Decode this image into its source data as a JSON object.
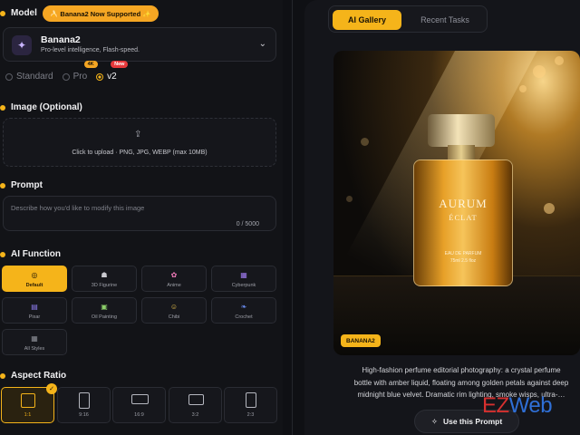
{
  "left": {
    "model": {
      "heading": "Model",
      "badge": "🍌 Banana2 Now Supported ✨",
      "name": "Banana2",
      "description": "Pro-level intelligence, Flash-speed.",
      "options": [
        {
          "label": "Standard",
          "selected": false
        },
        {
          "label": "Pro",
          "selected": false,
          "badge": "4K"
        },
        {
          "label": "v2",
          "selected": true,
          "badge": "New"
        }
      ]
    },
    "image": {
      "heading": "Image (Optional)",
      "upload_text": "Click to upload · PNG, JPG, WEBP (max 10MB)"
    },
    "prompt": {
      "heading": "Prompt",
      "placeholder": "Describe how you'd like to modify this image",
      "counter": "0 / 5000"
    },
    "ai_function": {
      "heading": "AI Function",
      "items": [
        {
          "label": "Default",
          "icon": "default-icon",
          "active": true
        },
        {
          "label": "3D Figurine",
          "icon": "figurine-icon",
          "active": false
        },
        {
          "label": "Anime",
          "icon": "anime-icon",
          "active": false
        },
        {
          "label": "Cyberpunk",
          "icon": "cyberpunk-icon",
          "active": false
        },
        {
          "label": "Pixar",
          "icon": "pixar-icon",
          "active": false
        },
        {
          "label": "Oil Painting",
          "icon": "oil-painting-icon",
          "active": false
        },
        {
          "label": "Chibi",
          "icon": "chibi-icon",
          "active": false
        },
        {
          "label": "Crochet",
          "icon": "crochet-icon",
          "active": false
        },
        {
          "label": "All Styles",
          "icon": "all-styles-icon",
          "active": false
        }
      ]
    },
    "aspect_ratio": {
      "heading": "Aspect Ratio",
      "items": [
        {
          "label": "1:1",
          "active": true
        },
        {
          "label": "9:16",
          "active": false
        },
        {
          "label": "16:9",
          "active": false
        },
        {
          "label": "3:2",
          "active": false
        },
        {
          "label": "2:3",
          "active": false
        }
      ]
    }
  },
  "right": {
    "tabs": [
      {
        "label": "AI Gallery",
        "active": true
      },
      {
        "label": "Recent Tasks",
        "active": false
      }
    ],
    "hero": {
      "badge": "BANANA2",
      "bottle_title": "AURUM",
      "bottle_subtitle": "ÉCLAT",
      "bottle_line1": "EAU DE PARFUM",
      "bottle_line2": "75ml    2.5 floz"
    },
    "description_lines": [
      "High-fashion perfume editorial photography: a crystal perfume",
      "bottle with amber liquid, floating among golden petals against deep",
      "midnight blue velvet. Dramatic rim lighting, smoke wisps, ultra-…"
    ],
    "use_button": "Use this Prompt"
  },
  "watermark": {
    "part1": "EZ",
    "part2": "Web"
  },
  "colors": {
    "accent": "#f5b41a",
    "background": "#0f1014",
    "panel": "#121317"
  }
}
